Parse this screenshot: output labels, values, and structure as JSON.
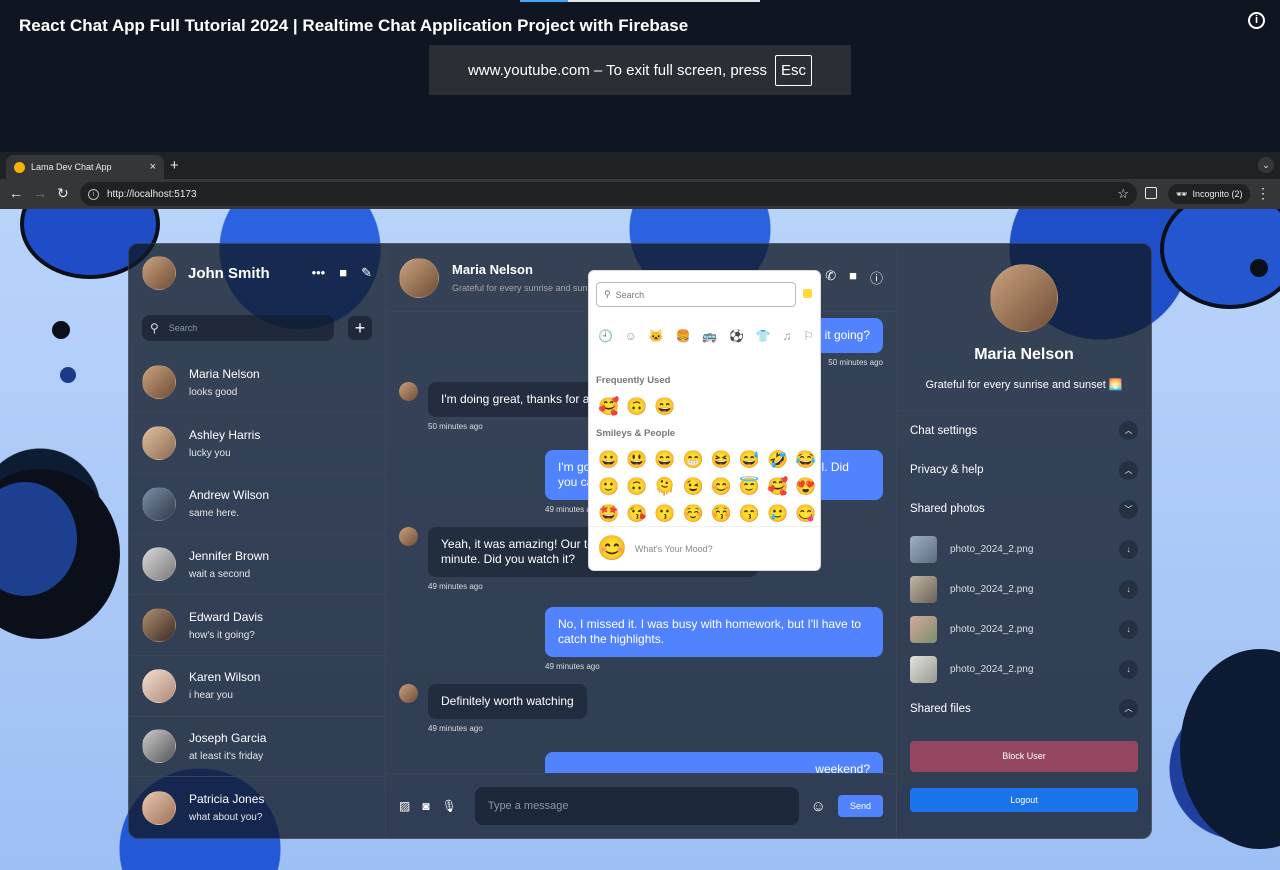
{
  "video": {
    "title": "React Chat App Full Tutorial 2024 | Realtime Chat Application Project with Firebase",
    "info_icon": "info-icon",
    "fullscreen_notice": "www.youtube.com – To exit full screen, press",
    "esc_key": "Esc"
  },
  "browser": {
    "tab_title": "Lama Dev Chat App",
    "tab_close": "×",
    "new_tab": "+",
    "url": "http://localhost:5173",
    "incognito_label": "Incognito (2)"
  },
  "app": {
    "current_user": {
      "name": "John Smith"
    },
    "search_placeholder": "Search",
    "add_label": "+",
    "chats": [
      {
        "name": "Maria Nelson",
        "last_message": "looks good"
      },
      {
        "name": "Ashley Harris",
        "last_message": "lucky you"
      },
      {
        "name": "Andrew Wilson",
        "last_message": "same here."
      },
      {
        "name": "Jennifer Brown",
        "last_message": "wait a second"
      },
      {
        "name": "Edward Davis",
        "last_message": "how's it going?"
      },
      {
        "name": "Karen Wilson",
        "last_message": "i hear you"
      },
      {
        "name": "Joseph Garcia",
        "last_message": "at least it's friday"
      },
      {
        "name": "Patricia Jones",
        "last_message": "what about you?"
      }
    ],
    "chat_header": {
      "name": "Maria Nelson",
      "status": "Grateful for every sunrise and sunset 🌅"
    },
    "messages": [
      {
        "own": true,
        "text": "how's it going?",
        "time": "50 minutes ago"
      },
      {
        "own": false,
        "text": "I'm doing great, thanks for asking. How about you?",
        "time": "50 minutes ago"
      },
      {
        "own": true,
        "text": "I'm good too, just working on some stuff for school. Did you catch the game last night?",
        "time": "49 minutes ago"
      },
      {
        "own": false,
        "text": "Yeah, it was amazing! Our team played well until the last minute. Did you watch it?",
        "time": "49 minutes ago"
      },
      {
        "own": true,
        "text": "No, I missed it. I was busy with homework, but I'll have to catch the highlights.",
        "time": "49 minutes ago"
      },
      {
        "own": false,
        "text": "Definitely worth watching",
        "time": "49 minutes ago"
      },
      {
        "own": true,
        "text": "weekend?",
        "time": ""
      }
    ],
    "input_placeholder": "Type a message",
    "send_label": "Send",
    "emoji_picker": {
      "search_placeholder": "Search",
      "frequently_used_label": "Frequently Used",
      "frequently_used": [
        "🥰",
        "🙃",
        "😄"
      ],
      "smileys_label": "Smileys & People",
      "smileys_rows": [
        [
          "😀",
          "😃",
          "😄",
          "😁",
          "😆",
          "😅",
          "🤣",
          "😂"
        ],
        [
          "🙂",
          "🙃",
          "🫠",
          "😉",
          "😊",
          "😇",
          "🥰",
          "😍"
        ],
        [
          "🤩",
          "😘",
          "😗",
          "☺️",
          "😚",
          "😙",
          "🥲",
          "😋"
        ]
      ],
      "categories": [
        "🕘",
        "☺",
        "🐱",
        "🍔",
        "🚌",
        "⚽",
        "👕",
        "♫",
        "⚐"
      ],
      "footer_emoji": "😊",
      "footer_text": "What's Your Mood?"
    },
    "detail": {
      "name": "Maria Nelson",
      "status": "Grateful for every sunrise and sunset 🌅",
      "options": {
        "chat_settings": "Chat settings",
        "privacy": "Privacy & help",
        "shared_photos": "Shared photos",
        "shared_files": "Shared files"
      },
      "photos": [
        "photo_2024_2.png",
        "photo_2024_2.png",
        "photo_2024_2.png",
        "photo_2024_2.png"
      ],
      "block_label": "Block User",
      "logout_label": "Logout"
    }
  },
  "colors": {
    "accent": "#5183fe",
    "block": "#e64a69",
    "logout": "#1a73e8"
  }
}
